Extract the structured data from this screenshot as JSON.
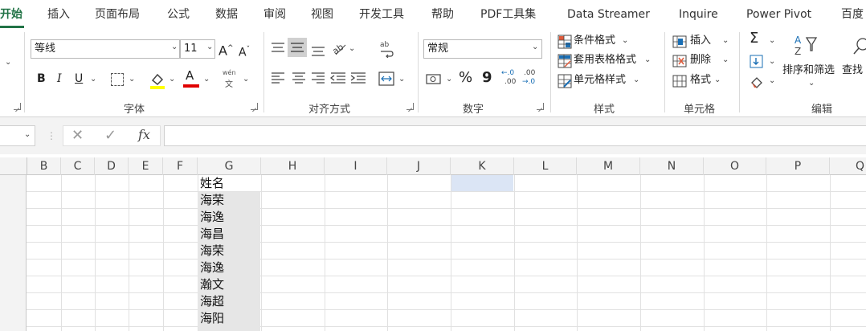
{
  "tabs": [
    "开始",
    "插入",
    "页面布局",
    "公式",
    "数据",
    "审阅",
    "视图",
    "开发工具",
    "帮助",
    "PDF工具集",
    "Data Streamer",
    "Inquire",
    "Power Pivot",
    "百度"
  ],
  "ribbon": {
    "font_name": "等线",
    "font_size": "11",
    "grow_font": "A",
    "shrink_font": "A",
    "bold": "B",
    "italic": "I",
    "underline": "U",
    "font_color_letter": "A",
    "phonetic": "wén",
    "phonetic_char": "文",
    "number_format": "常规",
    "percent": "%",
    "comma": "9",
    "inc_decimal_a": "←.0",
    "inc_decimal_b": ".00",
    "dec_decimal_a": ".00",
    "dec_decimal_b": "→.0",
    "conditional_format": "条件格式",
    "table_format": "套用表格格式",
    "cell_style": "单元格样式",
    "insert": "插入",
    "delete": "删除",
    "format": "格式",
    "sort_filter": "排序和筛选",
    "find_select": "查找",
    "groups": {
      "font": "字体",
      "alignment": "对齐方式",
      "number": "数字",
      "styles": "样式",
      "cells": "单元格",
      "editing": "编辑"
    }
  },
  "formula_bar": {
    "cancel": "✕",
    "enter": "✓",
    "fx": "fx",
    "content": ""
  },
  "columns": [
    "B",
    "C",
    "D",
    "E",
    "F",
    "G",
    "H",
    "I",
    "J",
    "K",
    "L",
    "M",
    "N",
    "O",
    "P",
    "Q"
  ],
  "column_g_values": [
    "姓名",
    "海荣",
    "海逸",
    "海昌",
    "海荣",
    "海逸",
    "瀚文",
    "海超",
    "海阳"
  ],
  "colors": {
    "accent": "#217346",
    "selection": "#e6e6e6",
    "active_cell": "#dbe5f5"
  }
}
